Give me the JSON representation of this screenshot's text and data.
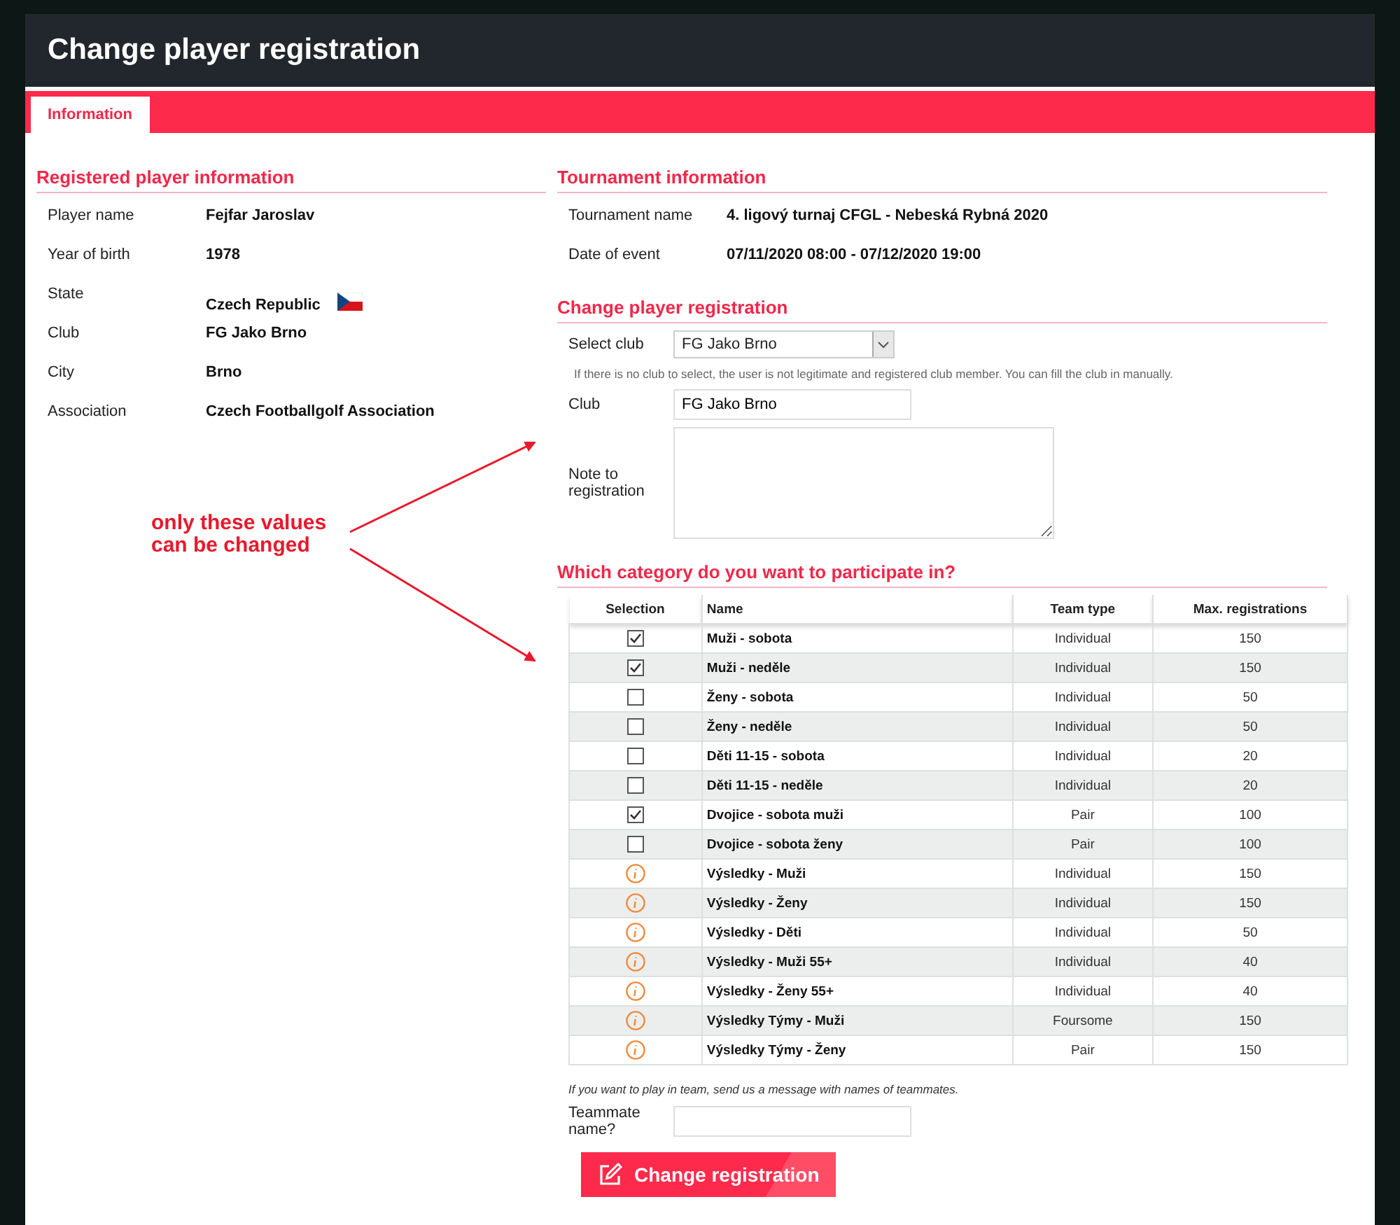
{
  "window": {
    "title": "Change player registration"
  },
  "tabs": [
    {
      "label": "Information",
      "selected": true
    }
  ],
  "player_info": {
    "heading": "Registered player information",
    "fields": [
      {
        "label": "Player name",
        "value": "Fejfar Jaroslav"
      },
      {
        "label": "Year of birth",
        "value": "1978"
      },
      {
        "label": "State",
        "value": "Czech Republic",
        "kind": "flag"
      },
      {
        "label": "Club",
        "value": "FG Jako Brno"
      },
      {
        "label": "City",
        "value": "Brno"
      },
      {
        "label": "Association",
        "value": "Czech Footballgolf Association"
      }
    ]
  },
  "tournament_info": {
    "heading": "Tournament information",
    "fields": [
      {
        "label": "Tournament name",
        "value": "4. ligový turnaj CFGL - Nebeská Rybná 2020"
      },
      {
        "label": "Date of event",
        "value": "07/11/2020 08:00 - 07/12/2020 19:00"
      }
    ]
  },
  "change_registration": {
    "heading": "Change player registration",
    "select_club": {
      "label": "Select club",
      "value": "FG Jako Brno"
    },
    "hint": "If there is no club to select, the user is not legitimate and registered club member. You can fill the club in manually.",
    "club": {
      "label": "Club",
      "value": "FG Jako Brno"
    },
    "note": {
      "label": "Note to registration"
    }
  },
  "categories": {
    "heading": "Which category do you want to participate in?",
    "columns": [
      "Selection",
      "Name",
      "Team type",
      "Max. registrations"
    ],
    "rows": [
      {
        "kind": "checkbox",
        "checked": true,
        "name": "Muži - sobota",
        "team_type": "Individual",
        "max": "150"
      },
      {
        "kind": "checkbox",
        "checked": true,
        "name": "Muži - neděle",
        "team_type": "Individual",
        "max": "150"
      },
      {
        "kind": "checkbox",
        "checked": false,
        "name": "Ženy - sobota",
        "team_type": "Individual",
        "max": "50"
      },
      {
        "kind": "checkbox",
        "checked": false,
        "name": "Ženy - neděle",
        "team_type": "Individual",
        "max": "50"
      },
      {
        "kind": "checkbox",
        "checked": false,
        "name": "Děti 11-15 - sobota",
        "team_type": "Individual",
        "max": "20"
      },
      {
        "kind": "checkbox",
        "checked": false,
        "name": "Děti 11-15 - neděle",
        "team_type": "Individual",
        "max": "20"
      },
      {
        "kind": "checkbox",
        "checked": true,
        "name": "Dvojice - sobota muži",
        "team_type": "Pair",
        "max": "100"
      },
      {
        "kind": "checkbox",
        "checked": false,
        "name": "Dvojice - sobota ženy",
        "team_type": "Pair",
        "max": "100"
      },
      {
        "kind": "info",
        "name": "Výsledky - Muži",
        "team_type": "Individual",
        "max": "150"
      },
      {
        "kind": "info",
        "name": "Výsledky - Ženy",
        "team_type": "Individual",
        "max": "150"
      },
      {
        "kind": "info",
        "name": "Výsledky - Děti",
        "team_type": "Individual",
        "max": "50"
      },
      {
        "kind": "info",
        "name": "Výsledky - Muži 55+",
        "team_type": "Individual",
        "max": "40"
      },
      {
        "kind": "info",
        "name": "Výsledky - Ženy 55+",
        "team_type": "Individual",
        "max": "40"
      },
      {
        "kind": "info",
        "name": "Výsledky Týmy - Muži",
        "team_type": "Foursome",
        "max": "150"
      },
      {
        "kind": "info",
        "name": "Výsledky Týmy - Ženy",
        "team_type": "Pair",
        "max": "150"
      }
    ]
  },
  "team_note": "If you want to play in team, send us a message with names of teammates.",
  "teammate": {
    "label": "Teammate name?"
  },
  "submit_button": "Change registration",
  "annotation": {
    "lines": [
      "only these values",
      "can be changed"
    ]
  }
}
